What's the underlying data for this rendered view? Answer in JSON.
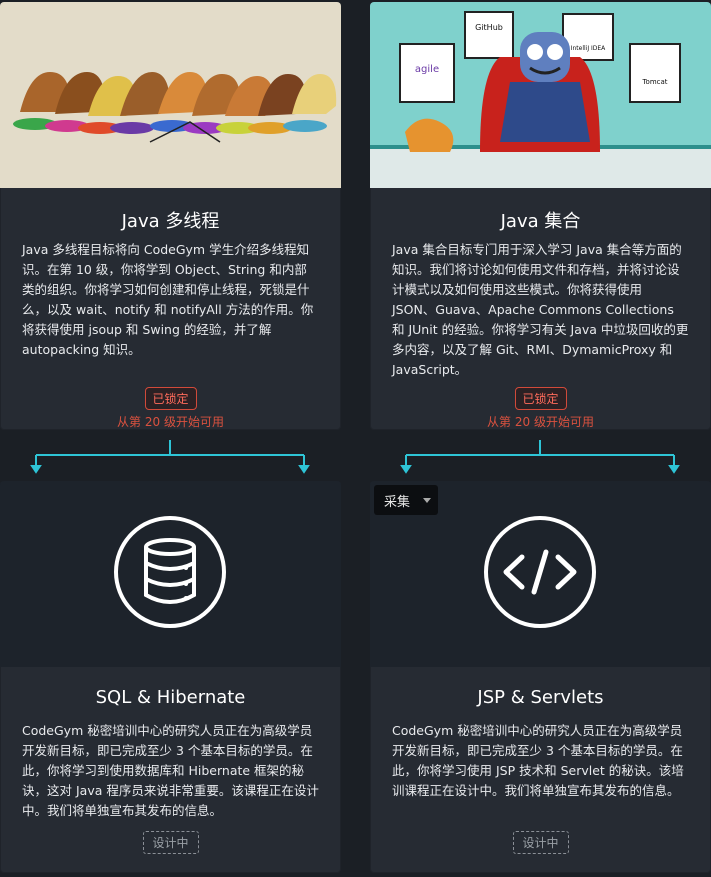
{
  "cards": [
    {
      "title": "Java 多线程",
      "description": "Java 多线程目标将向 CodeGym 学生介绍多线程知识。在第 10 级，你将学到 Object、String 和内部类的组织。你将学习如何创建和停止线程，死锁是什么，以及 wait、notify 和 notifyAll 方法的作用。你将获得使用 jsoup 和 Swing 的经验，并了解 autopacking 知识。",
      "status_label": "已锁定",
      "status_note": "从第 20 级开始可用"
    },
    {
      "title": "Java 集合",
      "description": "Java 集合目标专门用于深入学习 Java 集合等方面的知识。我们将讨论如何使用文件和存档，并将讨论设计模式以及如何使用这些模式。你将获得使用 JSON、Guava、Apache Commons Collections 和 JUnit 的经验。你将学习有关 Java 中垃圾回收的更多内容，以及了解 Git、RMI、DymamicProxy 和 JavaScript。",
      "status_label": "已锁定",
      "status_note": "从第 20 级开始可用",
      "image_badges": [
        "GitHub",
        "IntelliJ IDEA",
        "agile",
        "Tomcat"
      ]
    },
    {
      "title": "SQL & Hibernate",
      "description": "CodeGym 秘密培训中心的研究人员正在为高级学员开发新目标，即已完成至少 3 个基本目标的学员。在此，你将学习到使用数据库和 Hibernate 框架的秘诀，这对 Java 程序员来说非常重要。该课程正在设计中。我们将单独宣布其发布的信息。",
      "status_label": "设计中",
      "icon": "database-icon"
    },
    {
      "title": "JSP & Servlets",
      "description": "CodeGym 秘密培训中心的研究人员正在为高级学员开发新目标，即已完成至少 3 个基本目标的学员。在此，你将学习使用 JSP 技术和 Servlet 的秘诀。该培训课程正在设计中。我们将单独宣布其发布的信息。",
      "status_label": "设计中",
      "icon": "code-icon"
    }
  ],
  "dropdown": {
    "label": "采集"
  },
  "colors": {
    "connector": "#2ec4d6",
    "locked": "#d9513f",
    "card_bg": "#262b33",
    "page_bg": "#1b1f25"
  }
}
